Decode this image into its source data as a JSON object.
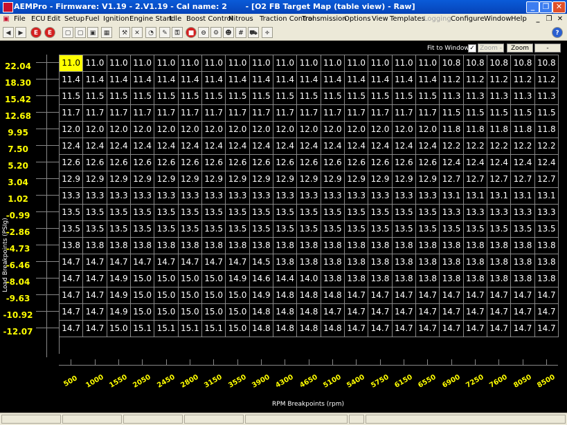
{
  "window": {
    "title": "AEMPro - Firmware: V1.19 - 2.V1.19 - Cal name: 2       - [O2 FB Target Map (table view) - Raw]",
    "minimize": "_",
    "restore": "❐",
    "close": "✕"
  },
  "menu": [
    {
      "label": "File",
      "disabled": false
    },
    {
      "label": "ECU",
      "disabled": false
    },
    {
      "label": "Edit",
      "disabled": false
    },
    {
      "label": "Setup",
      "disabled": false
    },
    {
      "label": "Fuel",
      "disabled": false
    },
    {
      "label": "Ignition",
      "disabled": false
    },
    {
      "label": "Engine Start",
      "disabled": false
    },
    {
      "label": "Idle",
      "disabled": false
    },
    {
      "label": "Boost Control",
      "disabled": false
    },
    {
      "label": "Nitrous",
      "disabled": false
    },
    {
      "label": "Traction Control",
      "disabled": false
    },
    {
      "label": "Transmission",
      "disabled": false
    },
    {
      "label": "Options",
      "disabled": false
    },
    {
      "label": "View",
      "disabled": false
    },
    {
      "label": "Templates",
      "disabled": false
    },
    {
      "label": "Logging",
      "disabled": true
    },
    {
      "label": "Configure",
      "disabled": false
    },
    {
      "label": "Window",
      "disabled": false
    },
    {
      "label": "Help",
      "disabled": false
    }
  ],
  "mdi_buttons": {
    "minimize": "_",
    "restore": "❐",
    "close": "✕"
  },
  "toolbar": {
    "icons": [
      "back-arrow-icon",
      "forward-arrow-icon",
      "ecu-icon",
      "upload-icon",
      "new-file-icon",
      "copy-file-icon",
      "save-icon",
      "graph-icon",
      "wrench-icon",
      "tools-icon",
      "gauge-icon",
      "wizard-icon",
      "connect-icon",
      "stop-icon",
      "record-icon",
      "settings-icon",
      "template-icon",
      "hash-icon",
      "car-icon",
      "math-icon"
    ],
    "help_icon": "help-icon"
  },
  "options": {
    "fit_to_window": "Fit to Window",
    "fit_checked": true,
    "zoom_out": "Zoom -",
    "zoom_in": "Zoom +",
    "to_graph": "->graph"
  },
  "table": {
    "y_axis_title": "Load Breakpoints (PSIg)",
    "x_axis_title": "RPM Breakpoints (rpm)",
    "y_breakpoints": [
      "22.04",
      "18.30",
      "15.42",
      "12.68",
      "9.95",
      "7.50",
      "5.20",
      "3.04",
      "1.02",
      "-0.99",
      "-2.86",
      "-4.73",
      "-6.46",
      "-8.04",
      "-9.63",
      "-10.92",
      "-12.07"
    ],
    "x_breakpoints": [
      "500",
      "1000",
      "1550",
      "2050",
      "2450",
      "2800",
      "3150",
      "3550",
      "3900",
      "4300",
      "4650",
      "5100",
      "5400",
      "5750",
      "6150",
      "6550",
      "6900",
      "7250",
      "7600",
      "8050",
      "8500"
    ],
    "selected_cell": [
      0,
      0
    ],
    "rows": [
      [
        "11.0",
        "11.0",
        "11.0",
        "11.0",
        "11.0",
        "11.0",
        "11.0",
        "11.0",
        "11.0",
        "11.0",
        "11.0",
        "11.0",
        "11.0",
        "11.0",
        "11.0",
        "11.0",
        "10.8",
        "10.8",
        "10.8",
        "10.8",
        "10.8"
      ],
      [
        "11.4",
        "11.4",
        "11.4",
        "11.4",
        "11.4",
        "11.4",
        "11.4",
        "11.4",
        "11.4",
        "11.4",
        "11.4",
        "11.4",
        "11.4",
        "11.4",
        "11.4",
        "11.4",
        "11.2",
        "11.2",
        "11.2",
        "11.2",
        "11.2"
      ],
      [
        "11.5",
        "11.5",
        "11.5",
        "11.5",
        "11.5",
        "11.5",
        "11.5",
        "11.5",
        "11.5",
        "11.5",
        "11.5",
        "11.5",
        "11.5",
        "11.5",
        "11.5",
        "11.5",
        "11.3",
        "11.3",
        "11.3",
        "11.3",
        "11.3"
      ],
      [
        "11.7",
        "11.7",
        "11.7",
        "11.7",
        "11.7",
        "11.7",
        "11.7",
        "11.7",
        "11.7",
        "11.7",
        "11.7",
        "11.7",
        "11.7",
        "11.7",
        "11.7",
        "11.7",
        "11.5",
        "11.5",
        "11.5",
        "11.5",
        "11.5"
      ],
      [
        "12.0",
        "12.0",
        "12.0",
        "12.0",
        "12.0",
        "12.0",
        "12.0",
        "12.0",
        "12.0",
        "12.0",
        "12.0",
        "12.0",
        "12.0",
        "12.0",
        "12.0",
        "12.0",
        "11.8",
        "11.8",
        "11.8",
        "11.8",
        "11.8"
      ],
      [
        "12.4",
        "12.4",
        "12.4",
        "12.4",
        "12.4",
        "12.4",
        "12.4",
        "12.4",
        "12.4",
        "12.4",
        "12.4",
        "12.4",
        "12.4",
        "12.4",
        "12.4",
        "12.4",
        "12.2",
        "12.2",
        "12.2",
        "12.2",
        "12.2"
      ],
      [
        "12.6",
        "12.6",
        "12.6",
        "12.6",
        "12.6",
        "12.6",
        "12.6",
        "12.6",
        "12.6",
        "12.6",
        "12.6",
        "12.6",
        "12.6",
        "12.6",
        "12.6",
        "12.6",
        "12.4",
        "12.4",
        "12.4",
        "12.4",
        "12.4"
      ],
      [
        "12.9",
        "12.9",
        "12.9",
        "12.9",
        "12.9",
        "12.9",
        "12.9",
        "12.9",
        "12.9",
        "12.9",
        "12.9",
        "12.9",
        "12.9",
        "12.9",
        "12.9",
        "12.9",
        "12.7",
        "12.7",
        "12.7",
        "12.7",
        "12.7"
      ],
      [
        "13.3",
        "13.3",
        "13.3",
        "13.3",
        "13.3",
        "13.3",
        "13.3",
        "13.3",
        "13.3",
        "13.3",
        "13.3",
        "13.3",
        "13.3",
        "13.3",
        "13.3",
        "13.3",
        "13.1",
        "13.1",
        "13.1",
        "13.1",
        "13.1"
      ],
      [
        "13.5",
        "13.5",
        "13.5",
        "13.5",
        "13.5",
        "13.5",
        "13.5",
        "13.5",
        "13.5",
        "13.5",
        "13.5",
        "13.5",
        "13.5",
        "13.5",
        "13.5",
        "13.5",
        "13.3",
        "13.3",
        "13.3",
        "13.3",
        "13.3"
      ],
      [
        "13.5",
        "13.5",
        "13.5",
        "13.5",
        "13.5",
        "13.5",
        "13.5",
        "13.5",
        "13.5",
        "13.5",
        "13.5",
        "13.5",
        "13.5",
        "13.5",
        "13.5",
        "13.5",
        "13.5",
        "13.5",
        "13.5",
        "13.5",
        "13.5"
      ],
      [
        "13.8",
        "13.8",
        "13.8",
        "13.8",
        "13.8",
        "13.8",
        "13.8",
        "13.8",
        "13.8",
        "13.8",
        "13.8",
        "13.8",
        "13.8",
        "13.8",
        "13.8",
        "13.8",
        "13.8",
        "13.8",
        "13.8",
        "13.8",
        "13.8"
      ],
      [
        "14.7",
        "14.7",
        "14.7",
        "14.7",
        "14.7",
        "14.7",
        "14.7",
        "14.7",
        "14.5",
        "13.8",
        "13.8",
        "13.8",
        "13.8",
        "13.8",
        "13.8",
        "13.8",
        "13.8",
        "13.8",
        "13.8",
        "13.8",
        "13.8"
      ],
      [
        "14.7",
        "14.7",
        "14.9",
        "15.0",
        "15.0",
        "15.0",
        "15.0",
        "14.9",
        "14.6",
        "14.4",
        "14.0",
        "13.8",
        "13.8",
        "13.8",
        "13.8",
        "13.8",
        "13.8",
        "13.8",
        "13.8",
        "13.8",
        "13.8"
      ],
      [
        "14.7",
        "14.7",
        "14.9",
        "15.0",
        "15.0",
        "15.0",
        "15.0",
        "15.0",
        "14.9",
        "14.8",
        "14.8",
        "14.8",
        "14.7",
        "14.7",
        "14.7",
        "14.7",
        "14.7",
        "14.7",
        "14.7",
        "14.7",
        "14.7"
      ],
      [
        "14.7",
        "14.7",
        "14.9",
        "15.0",
        "15.0",
        "15.0",
        "15.0",
        "15.0",
        "14.8",
        "14.8",
        "14.8",
        "14.7",
        "14.7",
        "14.7",
        "14.7",
        "14.7",
        "14.7",
        "14.7",
        "14.7",
        "14.7",
        "14.7"
      ],
      [
        "14.7",
        "14.7",
        "15.0",
        "15.1",
        "15.1",
        "15.1",
        "15.1",
        "15.0",
        "14.8",
        "14.8",
        "14.8",
        "14.8",
        "14.7",
        "14.7",
        "14.7",
        "14.7",
        "14.7",
        "14.7",
        "14.7",
        "14.7",
        "14.7"
      ]
    ]
  },
  "colors": {
    "axis_label": "#ffff00",
    "selected_cell": "#ffff00",
    "grid_line": "#888888",
    "background": "#000000"
  }
}
